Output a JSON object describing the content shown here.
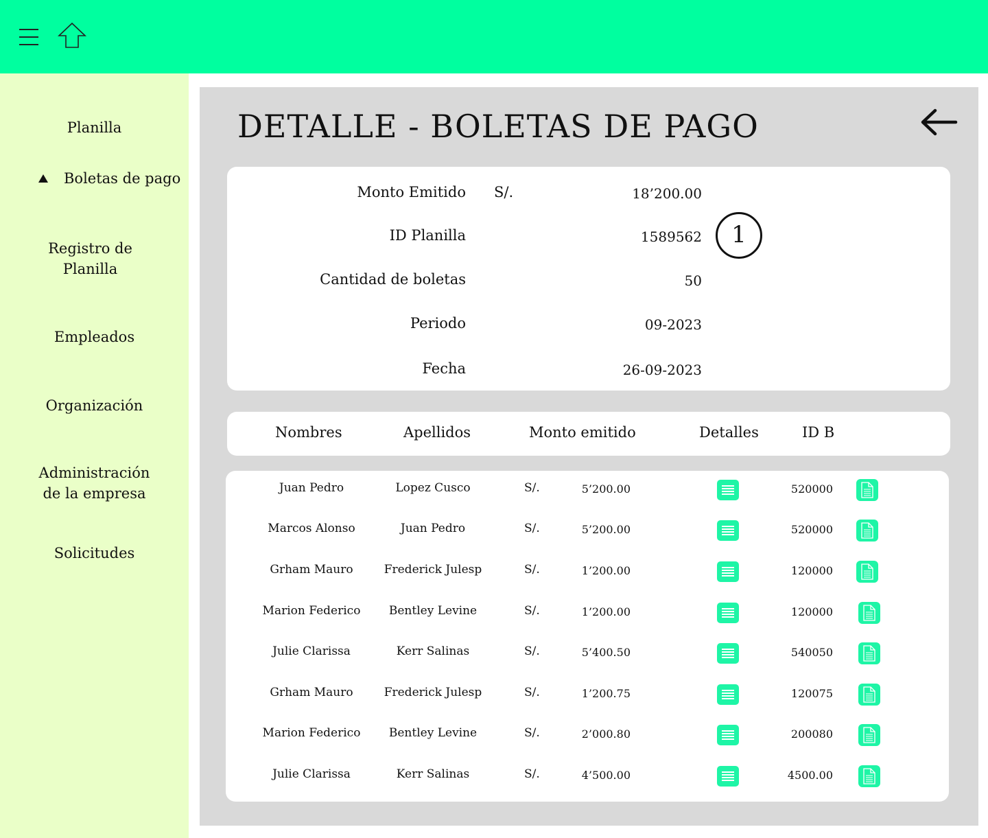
{
  "header": {
    "menu_icon": "hamburger-menu-icon",
    "home_icon": "home-arrow-icon",
    "color": "#00ff9f"
  },
  "sidebar": {
    "color": "#eaffc8",
    "items": [
      {
        "label": "Planilla"
      },
      {
        "label": "Boletas de pago",
        "active": true
      },
      {
        "label": "Registro de\nPlanilla"
      },
      {
        "label": "Empleados"
      },
      {
        "label": "Organización"
      },
      {
        "label": "Administración\nde la empresa"
      },
      {
        "label": "Solicitudes"
      }
    ]
  },
  "main": {
    "title": "DETALLE - BOLETAS DE PAGO",
    "back_icon": "arrow-left-icon",
    "summary": {
      "monto_label": "Monto Emitido",
      "monto_currency": "S/.",
      "monto_value": "18’200.00",
      "id_label": "ID Planilla",
      "id_value": "1589562",
      "cantidad_label": "Cantidad de boletas",
      "cantidad_value": "50",
      "periodo_label": "Periodo",
      "periodo_value": "09-2023",
      "fecha_label": "Fecha",
      "fecha_value": "26-09-2023",
      "badge": "1"
    },
    "table": {
      "headers": {
        "nombres": "Nombres",
        "apellidos": "Apellidos",
        "monto": "Monto emitido",
        "detalles": "Detalles",
        "id": "ID B"
      },
      "rows": [
        {
          "nombres": "Juan Pedro",
          "apellidos": "Lopez Cusco",
          "currency": "S/.",
          "monto": "5’200.00",
          "id": "520000"
        },
        {
          "nombres": "Marcos Alonso",
          "apellidos": "Juan Pedro",
          "currency": "S/.",
          "monto": "5’200.00",
          "id": "520000"
        },
        {
          "nombres": "Grham Mauro",
          "apellidos": "Frederick Julesp",
          "currency": "S/.",
          "monto": "1’200.00",
          "id": "120000"
        },
        {
          "nombres": "Marion Federico",
          "apellidos": "Bentley Levine",
          "currency": "S/.",
          "monto": "1’200.00",
          "id": "120000"
        },
        {
          "nombres": "Julie Clarissa",
          "apellidos": "Kerr Salinas",
          "currency": "S/.",
          "monto": "5’400.50",
          "id": "540050"
        },
        {
          "nombres": "Grham Mauro",
          "apellidos": "Frederick Julesp",
          "currency": "S/.",
          "monto": "1’200.75",
          "id": "120075"
        },
        {
          "nombres": "Marion Federico",
          "apellidos": "Bentley Levine",
          "currency": "S/.",
          "monto": "2’000.80",
          "id": "200080"
        },
        {
          "nombres": "Julie Clarissa",
          "apellidos": "Kerr Salinas",
          "currency": "S/.",
          "monto": "4’500.00",
          "id": "4500.00"
        }
      ],
      "detail_icon": "list-details-icon",
      "document_icon": "document-icon",
      "accent": "#1ef5a6"
    }
  }
}
